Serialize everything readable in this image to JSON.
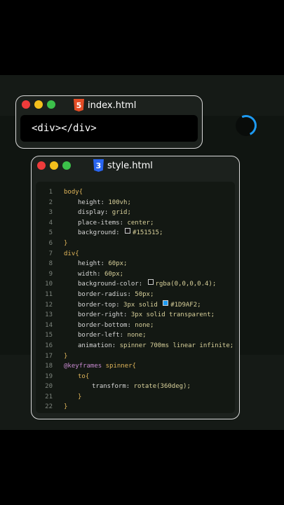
{
  "html_window": {
    "title": "index.html",
    "badge": "5",
    "code": "<div></div>"
  },
  "css_window": {
    "title": "style.html",
    "badge": "3",
    "line_numbers": [
      "1",
      "2",
      "3",
      "4",
      "5",
      "6",
      "7",
      "8",
      "9",
      "10",
      "11",
      "12",
      "13",
      "14",
      "15",
      "16",
      "17",
      "18",
      "19",
      "20",
      "21",
      "22"
    ],
    "lines": {
      "l1_sel": "body{",
      "l2_prop": "height: ",
      "l2_val": "100vh;",
      "l3_prop": "display: ",
      "l3_val": "grid;",
      "l4_prop": "place-items: ",
      "l4_val": "center;",
      "l5_prop": "background: ",
      "l5_val": "#151515;",
      "l6": "}",
      "l7_sel": "div{",
      "l8_prop": "height: ",
      "l8_val": "60px;",
      "l9_prop": "width: ",
      "l9_val": "60px;",
      "l10_prop": "background-color: ",
      "l10_val": "rgba(0,0,0,0.4);",
      "l11_prop": "border-radius: ",
      "l11_val": "50px;",
      "l12_prop": "border-top: ",
      "l12_val_a": "3px solid ",
      "l12_val_b": "#1D9AF2;",
      "l13_prop": "border-right: ",
      "l13_val": "3px solid transparent;",
      "l14_prop": "border-bottom: ",
      "l14_val": "none;",
      "l15_prop": "border-left: ",
      "l15_val": "none;",
      "l16_prop": "animation: ",
      "l16_val": "spinner 700ms linear infinite;",
      "l17": "}",
      "l18_kw": "@keyframes",
      "l18_sel": " spinner{",
      "l19": "to{",
      "l20_prop": "transform: ",
      "l20_val": "rotate(360deg);",
      "l21": "}",
      "l22": "}"
    }
  },
  "colors": {
    "background_swatch": "#151515",
    "rgba_swatch": "rgba(0,0,0,0.4)",
    "border_top_swatch": "#1D9AF2"
  }
}
